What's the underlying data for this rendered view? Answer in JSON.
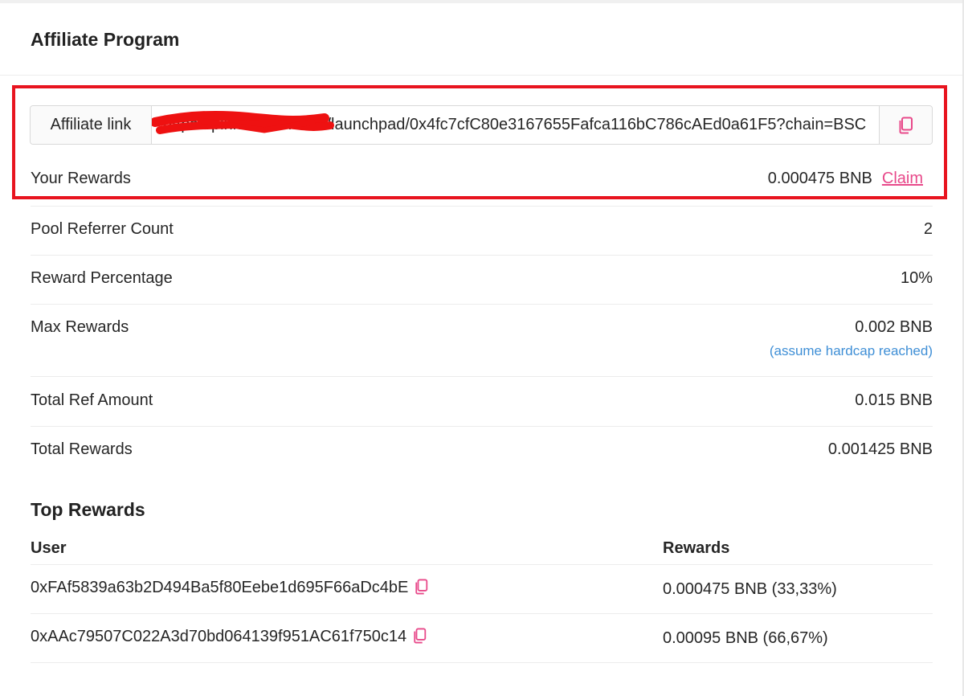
{
  "page": {
    "title": "Affiliate Program"
  },
  "affiliate": {
    "link_label": "Affiliate link",
    "link_value": "https://pinksale.finance/launchpad/0x4fc7cfC80e3167655Fafca116bC786cAEd0a61F5?chain=BSC",
    "copy_icon": "copy-icon"
  },
  "rewards": {
    "label": "Your Rewards",
    "value": "0.000475 BNB",
    "claim_label": "Claim"
  },
  "stats": {
    "pool_referrer_count": {
      "label": "Pool Referrer Count",
      "value": "2"
    },
    "reward_percentage": {
      "label": "Reward Percentage",
      "value": "10%"
    },
    "max_rewards": {
      "label": "Max Rewards",
      "value": "0.002 BNB",
      "note": "(assume hardcap reached)"
    },
    "total_ref_amount": {
      "label": "Total Ref Amount",
      "value": "0.015 BNB"
    },
    "total_rewards": {
      "label": "Total Rewards",
      "value": "0.001425 BNB"
    }
  },
  "top_rewards": {
    "title": "Top Rewards",
    "headers": {
      "user": "User",
      "rewards": "Rewards"
    },
    "rows": [
      {
        "user": "0xFAf5839a63b2D494Ba5f80Eebe1d695F66aDc4bE",
        "rewards": "0.000475 BNB (33,33%)"
      },
      {
        "user": "0xAAc79507C022A3d70bd064139f951AC61f750c14",
        "rewards": "0.00095 BNB (66,67%)"
      }
    ]
  },
  "colors": {
    "accent": "#e8498a",
    "success": "#47c06b",
    "info": "#3f8fd6",
    "highlight": "#e8141f"
  }
}
